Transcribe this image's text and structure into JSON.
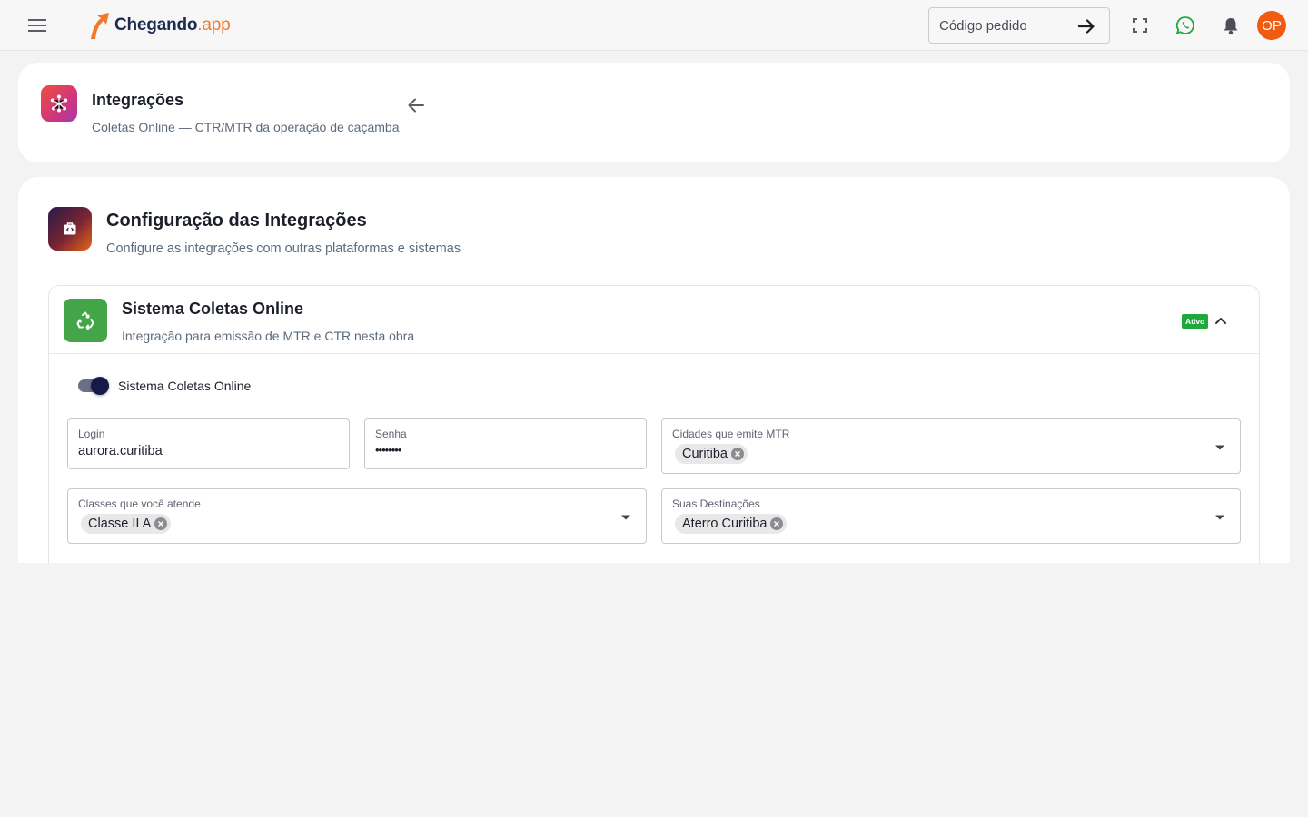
{
  "app": {
    "logo_main": "Chegando",
    "logo_suffix": ".app",
    "order_placeholder": "Código pedido",
    "avatar_initials": "OP",
    "brand_color": "#f07a2b",
    "avatar_color": "#f15a12"
  },
  "icons": {
    "menu": "menu-icon",
    "order_submit": "arrow-right-icon",
    "fullscreen": "fullscreen-icon",
    "whatsapp": "whatsapp-icon",
    "notifications": "bell-icon",
    "integrations": "integrations-hub-icon",
    "back": "arrow-left-icon",
    "config": "code-bag-icon",
    "coletas": "recycle-icon",
    "collapse": "chevron-up-icon",
    "dropdown": "caret-down-icon",
    "chip_remove": "cancel-circle-icon"
  },
  "header": {
    "title": "Integrações",
    "subtitle": "Coletas Online — CTR/MTR da operação de caçamba"
  },
  "config": {
    "title": "Configuração das Integrações",
    "subtitle": "Configure as integrações com outras plataformas e sistemas"
  },
  "panel": {
    "title": "Sistema Coletas Online",
    "subtitle": "Integração para emissão de MTR e CTR nesta obra",
    "status_badge": "Ativo",
    "status_color": "#1fa83b",
    "expanded": true
  },
  "form": {
    "toggle_label": "Sistema Coletas Online",
    "toggle_on": true,
    "login_label": "Login",
    "login_value": "aurora.curitiba",
    "password_label": "Senha",
    "password_value": "••••••••",
    "cities_label": "Cidades que emite MTR",
    "cities_selected": [
      "Curitiba"
    ],
    "classes_label": "Classes que você atende",
    "classes_selected": [
      "Classe II A"
    ],
    "destinations_label": "Suas Destinações",
    "destinations_selected": [
      "Aterro Curitiba"
    ]
  }
}
